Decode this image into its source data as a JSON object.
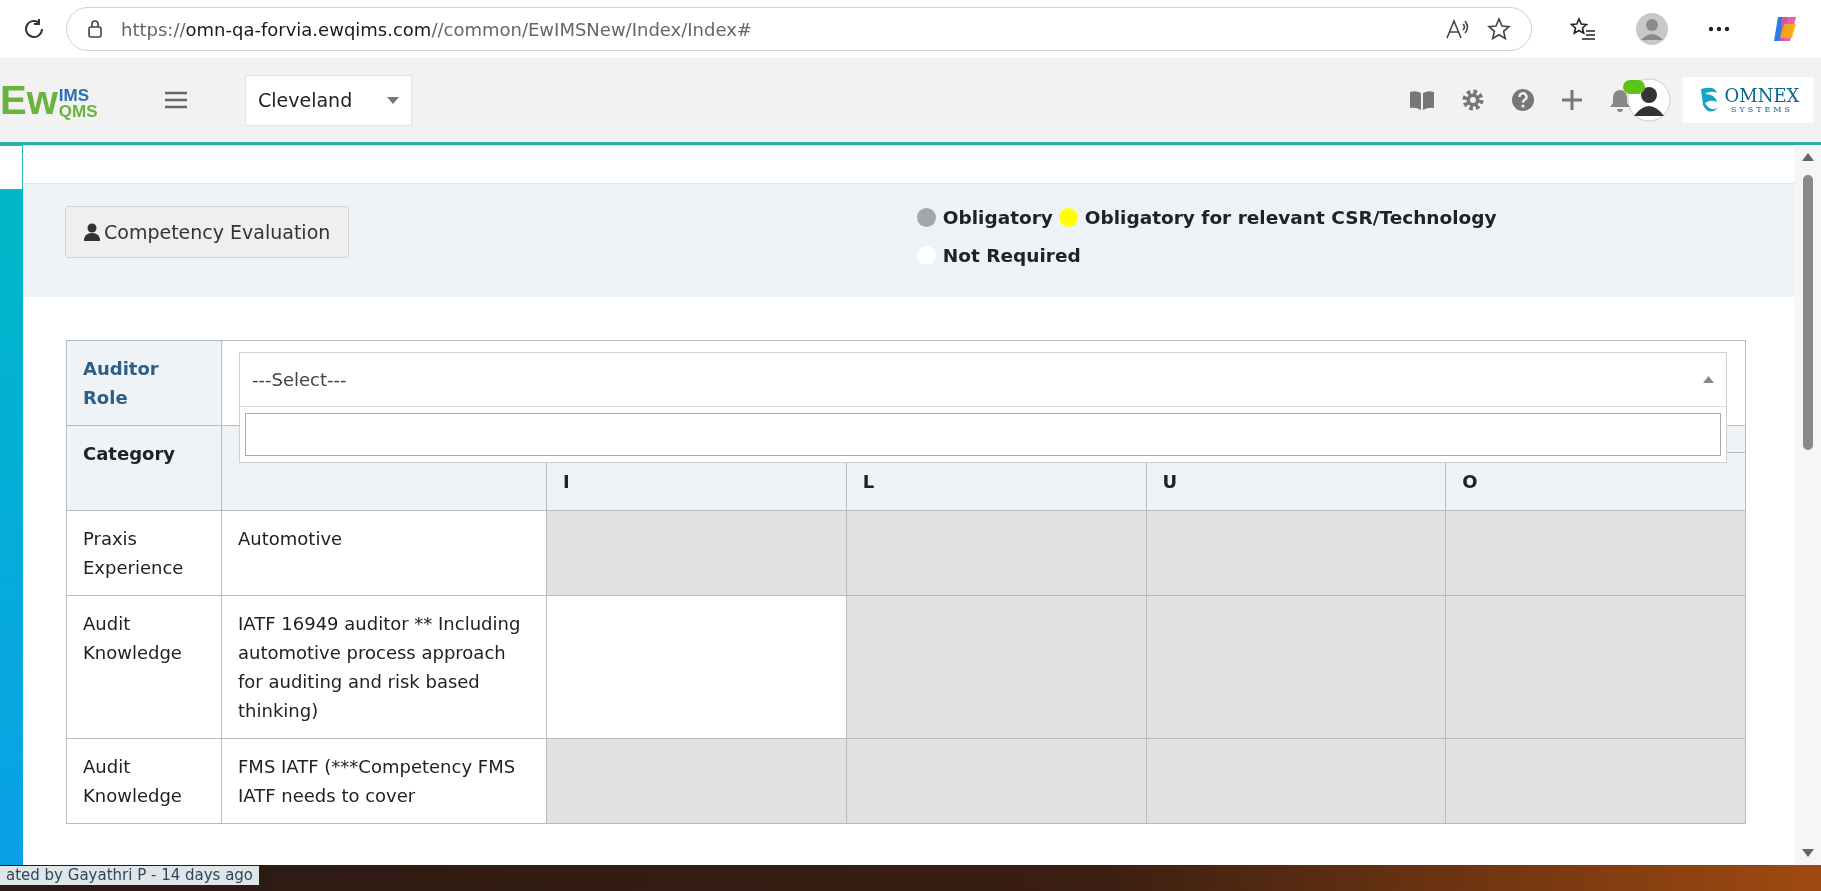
{
  "browser": {
    "scheme": "https://",
    "host": "omn-qa-forvia.ewqims.com",
    "path": "//common/EwIMSNew/Index/Index#"
  },
  "header": {
    "logo": {
      "main": "Ew",
      "top": "IMS",
      "bottom": "QMS"
    },
    "site": "Cleveland",
    "notification": true,
    "brand": {
      "name": "OMNEX",
      "sub": "SYSTEMS"
    }
  },
  "toolbar": {
    "button": "Competency Evaluation"
  },
  "legend": [
    {
      "label": "Obligatory",
      "color": "#a6a6a6"
    },
    {
      "label": "Obligatory for relevant CSR/Technology",
      "color": "#ffff00"
    },
    {
      "label": "Not Required",
      "color": "#ffffff"
    }
  ],
  "auditor_role": {
    "label": "Auditor Role",
    "value": "---Select---",
    "expanded": true
  },
  "table": {
    "category_header": "Category",
    "level_headers": [
      "I",
      "L",
      "U",
      "O"
    ],
    "rows": [
      {
        "category": "Praxis Experience",
        "item": "Automotive",
        "shaded": [
          true,
          true,
          true,
          true
        ]
      },
      {
        "category": "Audit Knowledge",
        "item": "IATF 16949 auditor ** Including automotive process approach for auditing and risk based thinking)",
        "shaded": [
          false,
          true,
          true,
          true
        ]
      },
      {
        "category": "Audit Knowledge",
        "item": "FMS IATF (***Competency FMS IATF needs to cover",
        "shaded": [
          true,
          true,
          true,
          true
        ]
      }
    ]
  },
  "footer": {
    "text": "ated by Gayathri P - 14 days ago"
  }
}
